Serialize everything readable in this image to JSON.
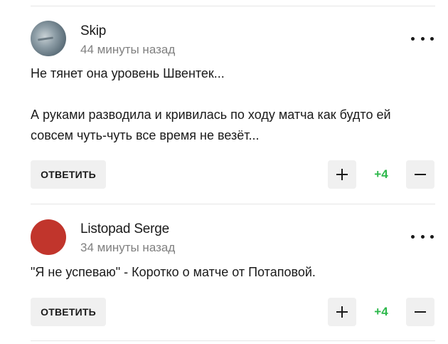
{
  "comments": [
    {
      "author": "Skip",
      "time": "44 минуты назад",
      "text": "Не тянет она уровень Швентек...\n\nА руками разводила и кривилась по ходу матча как будто ей совсем чуть-чуть все время не везёт...",
      "reply_label": "ОТВЕТИТЬ",
      "score": "+4",
      "avatar_icon": "user-photo-avatar"
    },
    {
      "author": "Listopad Serge",
      "time": "34 минуты назад",
      "text": "\"Я не успеваю\" - Коротко о матче от Потаповой.",
      "reply_label": "ОТВЕТИТЬ",
      "score": "+4",
      "avatar_icon": "user-avatar-placeholder",
      "avatar_color": "#c1352c"
    }
  ],
  "colors": {
    "score_positive": "#2db84b",
    "button_bg": "#f0f0f0",
    "meta_text": "#808080"
  }
}
